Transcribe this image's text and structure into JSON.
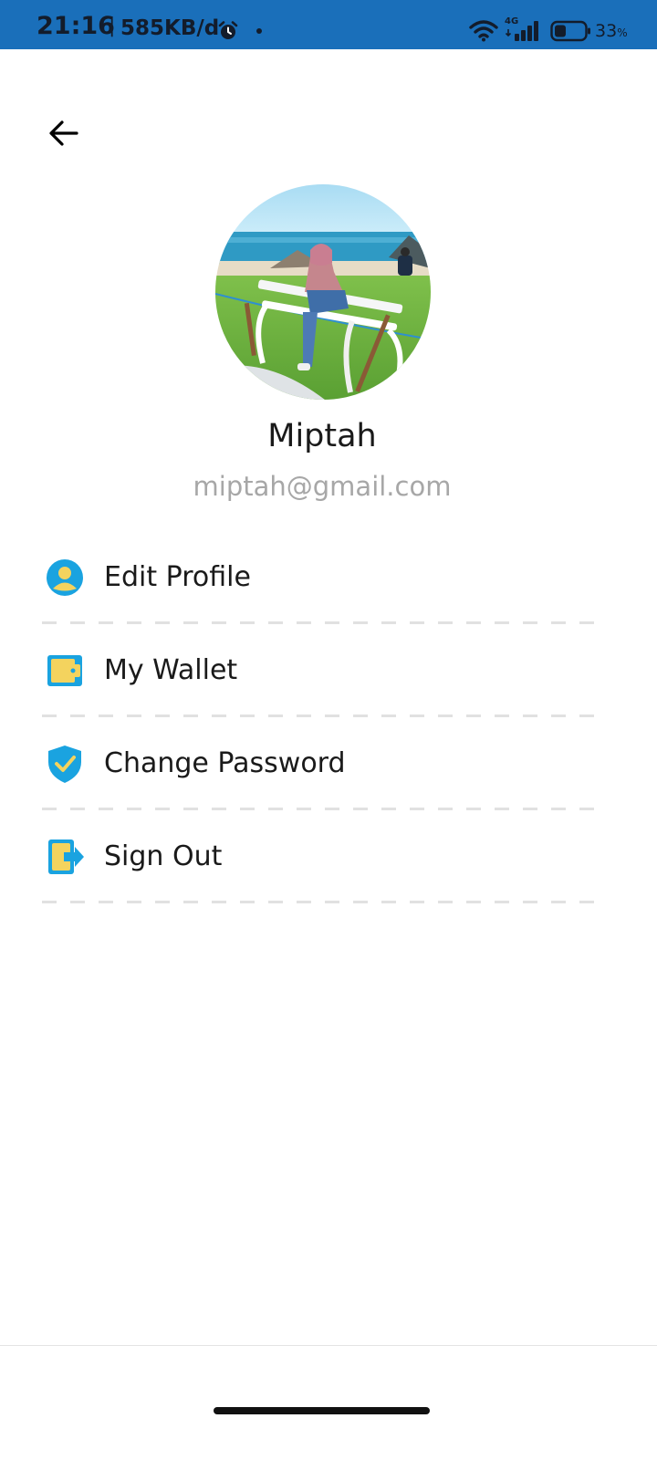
{
  "status_bar": {
    "time": "21:16",
    "separator": "|",
    "network_speed": "585KB/d",
    "network_type": "4G",
    "battery_percent": "33",
    "battery_unit": "%",
    "icons": [
      "alarm-icon",
      "wifi-icon",
      "signal-icon",
      "battery-icon"
    ],
    "background_color": "#1a6fba"
  },
  "header": {
    "back_icon": "arrow-left-icon"
  },
  "profile": {
    "name": "Miptah",
    "email": "miptah@gmail.com"
  },
  "menu": {
    "items": [
      {
        "label": "Edit Profile",
        "icon": "user-circle-icon"
      },
      {
        "label": "My Wallet",
        "icon": "wallet-icon"
      },
      {
        "label": "Change Password",
        "icon": "shield-check-icon"
      },
      {
        "label": "Sign Out",
        "icon": "sign-out-icon"
      }
    ]
  },
  "colors": {
    "icon_blue": "#1aa3e0",
    "icon_yellow": "#f4d35e",
    "text_primary": "#1a1a1a",
    "text_secondary": "#a7a7a7",
    "divider": "#e1e1e1"
  }
}
